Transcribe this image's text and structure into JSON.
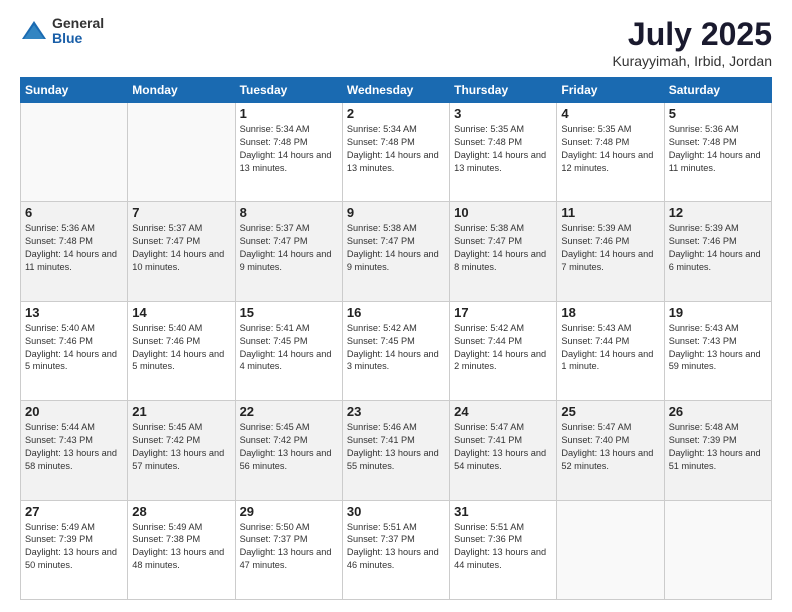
{
  "logo": {
    "general": "General",
    "blue": "Blue"
  },
  "header": {
    "month": "July 2025",
    "location": "Kurayyimah, Irbid, Jordan"
  },
  "days_of_week": [
    "Sunday",
    "Monday",
    "Tuesday",
    "Wednesday",
    "Thursday",
    "Friday",
    "Saturday"
  ],
  "weeks": [
    [
      {
        "day": "",
        "sunrise": "",
        "sunset": "",
        "daylight": ""
      },
      {
        "day": "",
        "sunrise": "",
        "sunset": "",
        "daylight": ""
      },
      {
        "day": "1",
        "sunrise": "Sunrise: 5:34 AM",
        "sunset": "Sunset: 7:48 PM",
        "daylight": "Daylight: 14 hours and 13 minutes."
      },
      {
        "day": "2",
        "sunrise": "Sunrise: 5:34 AM",
        "sunset": "Sunset: 7:48 PM",
        "daylight": "Daylight: 14 hours and 13 minutes."
      },
      {
        "day": "3",
        "sunrise": "Sunrise: 5:35 AM",
        "sunset": "Sunset: 7:48 PM",
        "daylight": "Daylight: 14 hours and 13 minutes."
      },
      {
        "day": "4",
        "sunrise": "Sunrise: 5:35 AM",
        "sunset": "Sunset: 7:48 PM",
        "daylight": "Daylight: 14 hours and 12 minutes."
      },
      {
        "day": "5",
        "sunrise": "Sunrise: 5:36 AM",
        "sunset": "Sunset: 7:48 PM",
        "daylight": "Daylight: 14 hours and 11 minutes."
      }
    ],
    [
      {
        "day": "6",
        "sunrise": "Sunrise: 5:36 AM",
        "sunset": "Sunset: 7:48 PM",
        "daylight": "Daylight: 14 hours and 11 minutes."
      },
      {
        "day": "7",
        "sunrise": "Sunrise: 5:37 AM",
        "sunset": "Sunset: 7:47 PM",
        "daylight": "Daylight: 14 hours and 10 minutes."
      },
      {
        "day": "8",
        "sunrise": "Sunrise: 5:37 AM",
        "sunset": "Sunset: 7:47 PM",
        "daylight": "Daylight: 14 hours and 9 minutes."
      },
      {
        "day": "9",
        "sunrise": "Sunrise: 5:38 AM",
        "sunset": "Sunset: 7:47 PM",
        "daylight": "Daylight: 14 hours and 9 minutes."
      },
      {
        "day": "10",
        "sunrise": "Sunrise: 5:38 AM",
        "sunset": "Sunset: 7:47 PM",
        "daylight": "Daylight: 14 hours and 8 minutes."
      },
      {
        "day": "11",
        "sunrise": "Sunrise: 5:39 AM",
        "sunset": "Sunset: 7:46 PM",
        "daylight": "Daylight: 14 hours and 7 minutes."
      },
      {
        "day": "12",
        "sunrise": "Sunrise: 5:39 AM",
        "sunset": "Sunset: 7:46 PM",
        "daylight": "Daylight: 14 hours and 6 minutes."
      }
    ],
    [
      {
        "day": "13",
        "sunrise": "Sunrise: 5:40 AM",
        "sunset": "Sunset: 7:46 PM",
        "daylight": "Daylight: 14 hours and 5 minutes."
      },
      {
        "day": "14",
        "sunrise": "Sunrise: 5:40 AM",
        "sunset": "Sunset: 7:46 PM",
        "daylight": "Daylight: 14 hours and 5 minutes."
      },
      {
        "day": "15",
        "sunrise": "Sunrise: 5:41 AM",
        "sunset": "Sunset: 7:45 PM",
        "daylight": "Daylight: 14 hours and 4 minutes."
      },
      {
        "day": "16",
        "sunrise": "Sunrise: 5:42 AM",
        "sunset": "Sunset: 7:45 PM",
        "daylight": "Daylight: 14 hours and 3 minutes."
      },
      {
        "day": "17",
        "sunrise": "Sunrise: 5:42 AM",
        "sunset": "Sunset: 7:44 PM",
        "daylight": "Daylight: 14 hours and 2 minutes."
      },
      {
        "day": "18",
        "sunrise": "Sunrise: 5:43 AM",
        "sunset": "Sunset: 7:44 PM",
        "daylight": "Daylight: 14 hours and 1 minute."
      },
      {
        "day": "19",
        "sunrise": "Sunrise: 5:43 AM",
        "sunset": "Sunset: 7:43 PM",
        "daylight": "Daylight: 13 hours and 59 minutes."
      }
    ],
    [
      {
        "day": "20",
        "sunrise": "Sunrise: 5:44 AM",
        "sunset": "Sunset: 7:43 PM",
        "daylight": "Daylight: 13 hours and 58 minutes."
      },
      {
        "day": "21",
        "sunrise": "Sunrise: 5:45 AM",
        "sunset": "Sunset: 7:42 PM",
        "daylight": "Daylight: 13 hours and 57 minutes."
      },
      {
        "day": "22",
        "sunrise": "Sunrise: 5:45 AM",
        "sunset": "Sunset: 7:42 PM",
        "daylight": "Daylight: 13 hours and 56 minutes."
      },
      {
        "day": "23",
        "sunrise": "Sunrise: 5:46 AM",
        "sunset": "Sunset: 7:41 PM",
        "daylight": "Daylight: 13 hours and 55 minutes."
      },
      {
        "day": "24",
        "sunrise": "Sunrise: 5:47 AM",
        "sunset": "Sunset: 7:41 PM",
        "daylight": "Daylight: 13 hours and 54 minutes."
      },
      {
        "day": "25",
        "sunrise": "Sunrise: 5:47 AM",
        "sunset": "Sunset: 7:40 PM",
        "daylight": "Daylight: 13 hours and 52 minutes."
      },
      {
        "day": "26",
        "sunrise": "Sunrise: 5:48 AM",
        "sunset": "Sunset: 7:39 PM",
        "daylight": "Daylight: 13 hours and 51 minutes."
      }
    ],
    [
      {
        "day": "27",
        "sunrise": "Sunrise: 5:49 AM",
        "sunset": "Sunset: 7:39 PM",
        "daylight": "Daylight: 13 hours and 50 minutes."
      },
      {
        "day": "28",
        "sunrise": "Sunrise: 5:49 AM",
        "sunset": "Sunset: 7:38 PM",
        "daylight": "Daylight: 13 hours and 48 minutes."
      },
      {
        "day": "29",
        "sunrise": "Sunrise: 5:50 AM",
        "sunset": "Sunset: 7:37 PM",
        "daylight": "Daylight: 13 hours and 47 minutes."
      },
      {
        "day": "30",
        "sunrise": "Sunrise: 5:51 AM",
        "sunset": "Sunset: 7:37 PM",
        "daylight": "Daylight: 13 hours and 46 minutes."
      },
      {
        "day": "31",
        "sunrise": "Sunrise: 5:51 AM",
        "sunset": "Sunset: 7:36 PM",
        "daylight": "Daylight: 13 hours and 44 minutes."
      },
      {
        "day": "",
        "sunrise": "",
        "sunset": "",
        "daylight": ""
      },
      {
        "day": "",
        "sunrise": "",
        "sunset": "",
        "daylight": ""
      }
    ]
  ]
}
